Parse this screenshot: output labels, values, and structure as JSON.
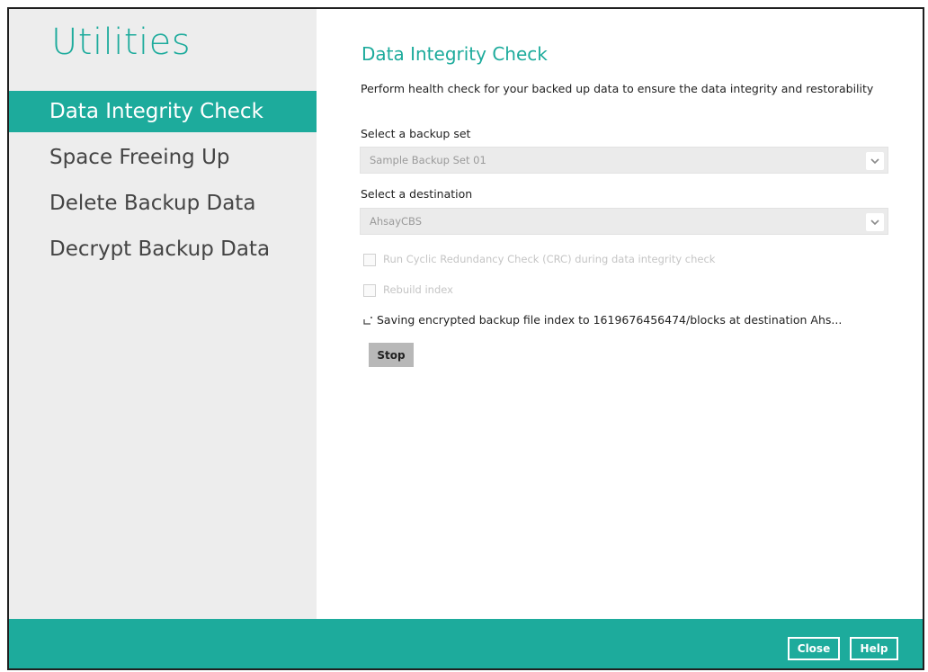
{
  "sidebar": {
    "title": "Utilities",
    "items": [
      {
        "label": "Data Integrity Check",
        "active": true
      },
      {
        "label": "Space Freeing Up",
        "active": false
      },
      {
        "label": "Delete Backup Data",
        "active": false
      },
      {
        "label": "Decrypt Backup Data",
        "active": false
      }
    ]
  },
  "main": {
    "title": "Data Integrity Check",
    "description": "Perform health check for your backed up data to ensure the data integrity and restorability",
    "backup_set": {
      "label": "Select a backup set",
      "value": "Sample Backup Set 01"
    },
    "destination": {
      "label": "Select a destination",
      "value": "AhsayCBS"
    },
    "options": [
      {
        "label": "Run Cyclic Redundancy Check (CRC) during data integrity check",
        "checked": false,
        "enabled": false
      },
      {
        "label": "Rebuild index",
        "checked": false,
        "enabled": false
      }
    ],
    "status_text": "Saving encrypted backup file index to 1619676456474/blocks at destination Ahs...",
    "stop_label": "Stop"
  },
  "footer": {
    "close_label": "Close",
    "help_label": "Help"
  },
  "colors": {
    "accent": "#1dab9c",
    "sidebar_bg": "#ededed"
  }
}
